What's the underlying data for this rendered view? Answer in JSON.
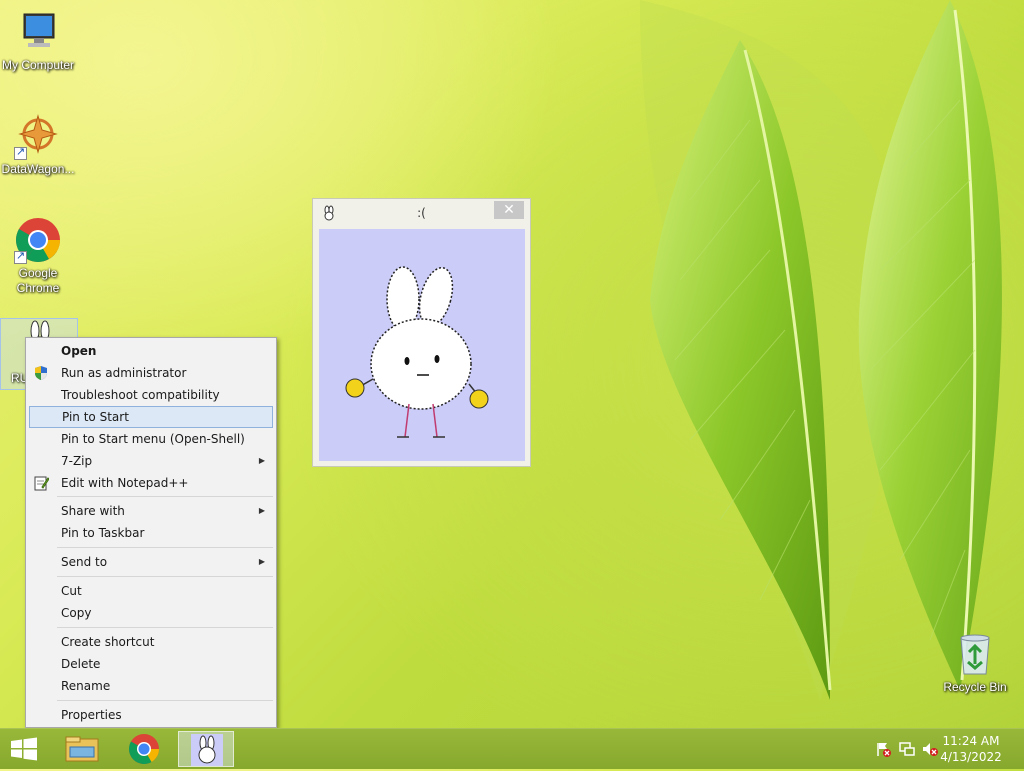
{
  "desktop": {
    "icons": [
      {
        "label": "My Computer"
      },
      {
        "label": "DataWagon..."
      },
      {
        "label": "Google Chrome"
      },
      {
        "label": "RU"
      },
      {
        "label": "Recycle Bin"
      }
    ]
  },
  "bunny_window": {
    "title": ":(",
    "close_glyph": "✕"
  },
  "context_menu": {
    "items": [
      {
        "label": "Open"
      },
      {
        "label": "Run as administrator"
      },
      {
        "label": "Troubleshoot compatibility"
      },
      {
        "label": "Pin to Start"
      },
      {
        "label": "Pin to Start menu (Open-Shell)"
      },
      {
        "label": "7-Zip"
      },
      {
        "label": "Edit with Notepad++"
      },
      {
        "label": "Share with"
      },
      {
        "label": "Pin to Taskbar"
      },
      {
        "label": "Send to"
      },
      {
        "label": "Cut"
      },
      {
        "label": "Copy"
      },
      {
        "label": "Create shortcut"
      },
      {
        "label": "Delete"
      },
      {
        "label": "Rename"
      },
      {
        "label": "Properties"
      }
    ],
    "submenu_arrow": "▶"
  },
  "taskbar": {
    "clock": {
      "time": "11:24 AM",
      "date": "4/13/2022"
    },
    "pinned": [
      "windows-start-icon",
      "file-explorer-icon",
      "chrome-icon",
      "bunny-app-icon"
    ],
    "tray": [
      "action-center-flag-icon",
      "network-icon",
      "volume-muted-icon"
    ]
  },
  "colors": {
    "menu_highlight": "#dce8f5",
    "menu_highlight_border": "#8fb2dc",
    "bunny_bg": "#ccccf8",
    "taskbar": "#8fb034"
  }
}
